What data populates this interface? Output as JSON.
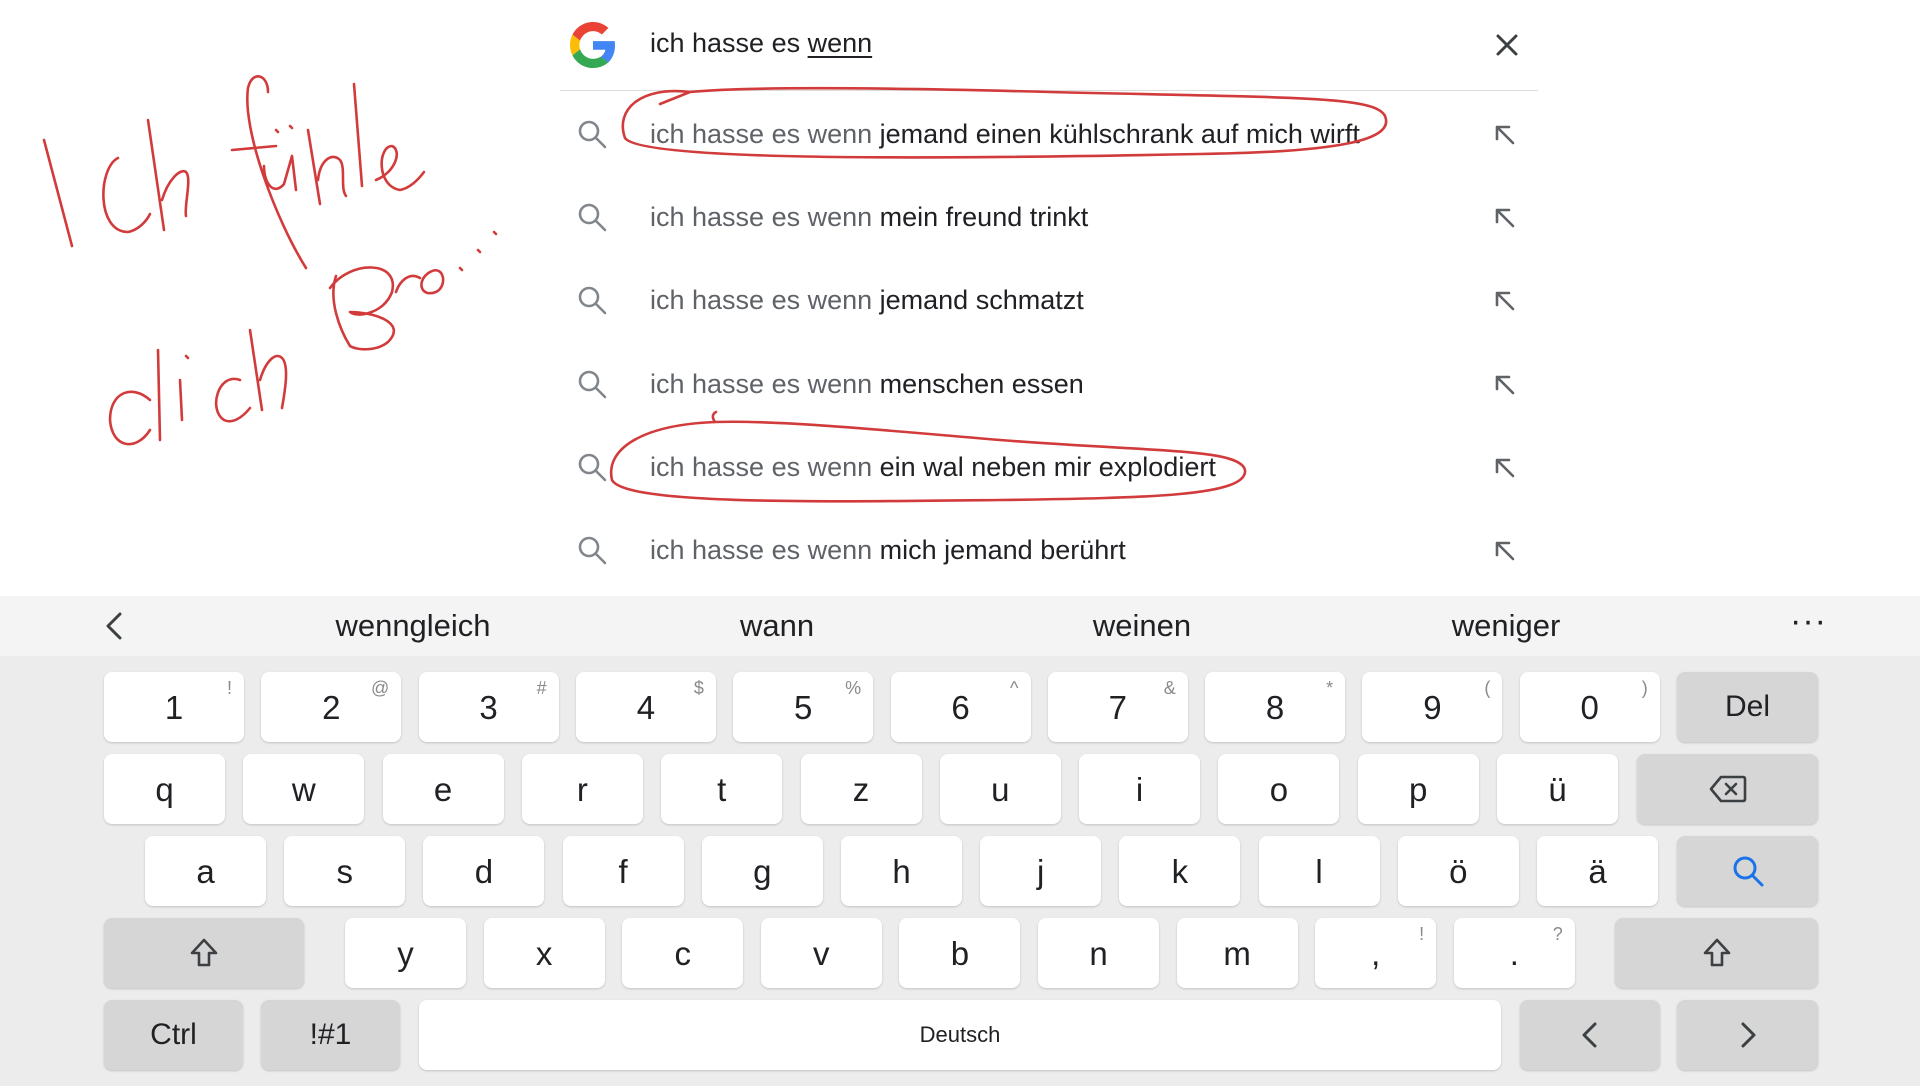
{
  "search": {
    "query_prefix": "ich hasse es ",
    "query_typed": "wenn",
    "logo": "google-g-logo",
    "clear_icon": "close-icon"
  },
  "suggestions": [
    {
      "prefix": "ich hasse es wenn ",
      "suffix": "jemand einen kühlschrank auf mich wirft",
      "circled": true
    },
    {
      "prefix": "ich hasse es wenn ",
      "suffix": "mein freund trinkt",
      "circled": false
    },
    {
      "prefix": "ich hasse es wenn ",
      "suffix": "jemand schmatzt",
      "circled": false
    },
    {
      "prefix": "ich hasse es wenn ",
      "suffix": "menschen essen",
      "circled": false
    },
    {
      "prefix": "ich hasse es wenn ",
      "suffix": "ein wal neben mir explodiert",
      "circled": true
    },
    {
      "prefix": "ich hasse es wenn ",
      "suffix": "mich jemand berührt",
      "circled": false
    }
  ],
  "annotation": {
    "handwriting_line1": "Ich fühle",
    "handwriting_line2": "dich Bro...",
    "ink_color": "#d23b3b"
  },
  "keyboard": {
    "predictions": [
      "wenngleich",
      "wann",
      "weinen",
      "weniger"
    ],
    "more_label": "···",
    "number_row": [
      {
        "main": "1",
        "sym": "!"
      },
      {
        "main": "2",
        "sym": "@"
      },
      {
        "main": "3",
        "sym": "#"
      },
      {
        "main": "4",
        "sym": "$"
      },
      {
        "main": "5",
        "sym": "%"
      },
      {
        "main": "6",
        "sym": "^"
      },
      {
        "main": "7",
        "sym": "&"
      },
      {
        "main": "8",
        "sym": "*"
      },
      {
        "main": "9",
        "sym": "("
      },
      {
        "main": "0",
        "sym": ")"
      }
    ],
    "del_label": "Del",
    "row_q": [
      "q",
      "w",
      "e",
      "r",
      "t",
      "z",
      "u",
      "i",
      "o",
      "p",
      "ü"
    ],
    "row_a": [
      "a",
      "s",
      "d",
      "f",
      "g",
      "h",
      "j",
      "k",
      "l",
      "ö",
      "ä"
    ],
    "row_y": [
      {
        "main": "y",
        "sym": ""
      },
      {
        "main": "x",
        "sym": ""
      },
      {
        "main": "c",
        "sym": ""
      },
      {
        "main": "v",
        "sym": ""
      },
      {
        "main": "b",
        "sym": ""
      },
      {
        "main": "n",
        "sym": ""
      },
      {
        "main": "m",
        "sym": ""
      },
      {
        "main": ",",
        "sym": "!"
      },
      {
        "main": ".",
        "sym": "?"
      }
    ],
    "ctrl_label": "Ctrl",
    "symbols_label": "!#1",
    "space_label": "Deutsch",
    "accent_color": "#1a73e8"
  }
}
